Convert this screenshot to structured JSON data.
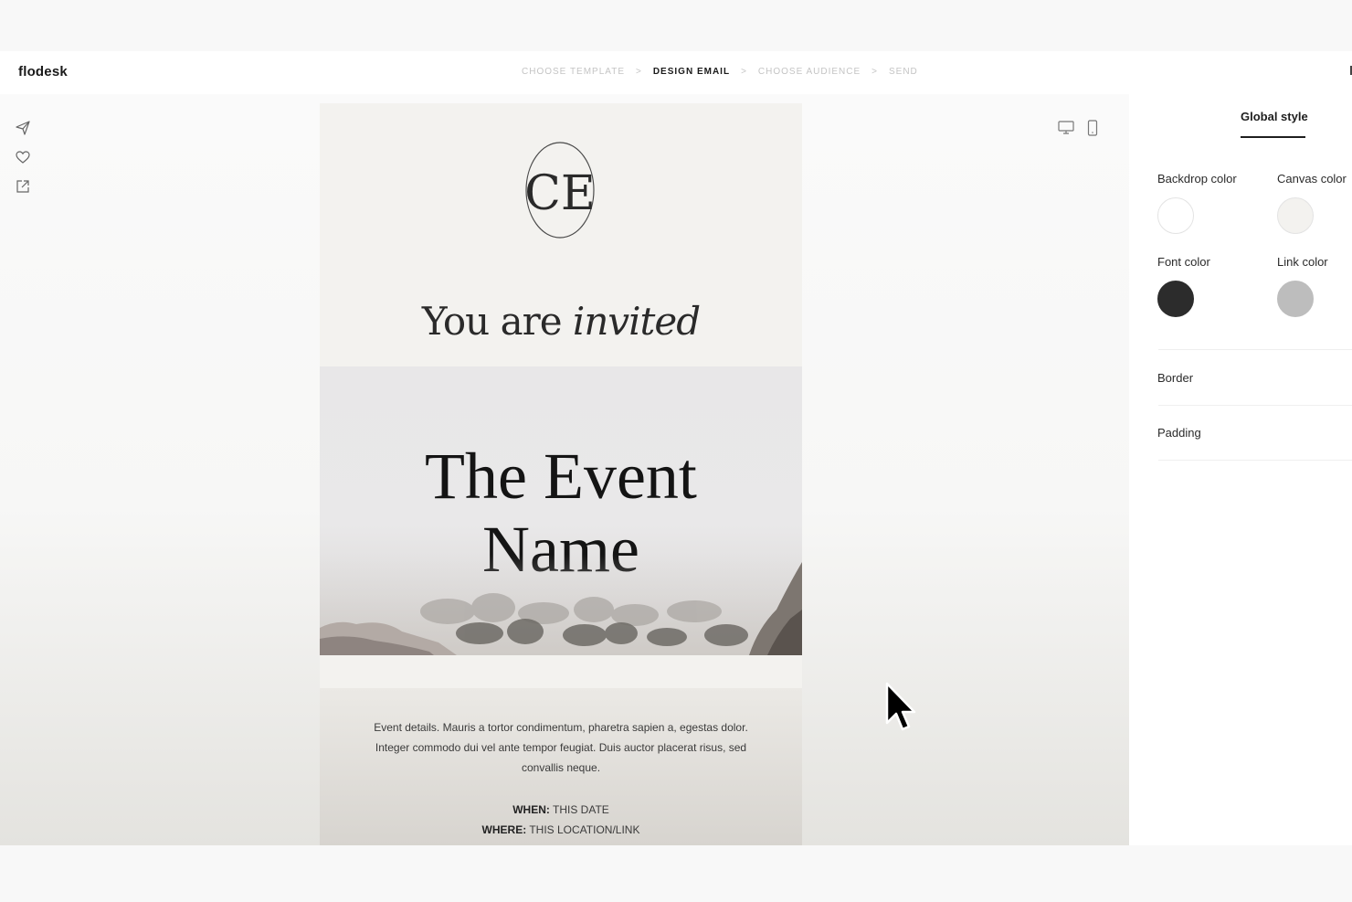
{
  "app": {
    "brand": "flodesk"
  },
  "steps": {
    "choose_template": "CHOOSE TEMPLATE",
    "design_email": "DESIGN EMAIL",
    "choose_audience": "CHOOSE AUDIENCE",
    "send": "SEND",
    "separator": ">",
    "active": "DESIGN EMAIL"
  },
  "left_tools": [
    "send-icon",
    "heart-icon",
    "external-link-icon"
  ],
  "view_toggles": [
    "desktop-icon",
    "mobile-icon"
  ],
  "email": {
    "monogram": "CE",
    "invited_plain": "You are ",
    "invited_italic": "invited",
    "event_name_line1": "The Event",
    "event_name_line2": "Name",
    "details": "Event details. Mauris a tortor condimentum, pharetra sapien a, egestas dolor. Integer commodo dui vel ante tempor feugiat. Duis auctor placerat risus, sed convallis neque.",
    "when_label": "WHEN:",
    "when_value": " THIS DATE",
    "where_label": "WHERE:",
    "where_value": " THIS LOCATION/LINK"
  },
  "panel": {
    "tab": "Global style",
    "backdrop_color_label": "Backdrop color",
    "canvas_color_label": "Canvas color",
    "font_color_label": "Font color",
    "link_color_label": "Link color",
    "border_label": "Border",
    "padding_label": "Padding",
    "colors": {
      "backdrop": "#ffffff",
      "canvas": "#f3f2ef",
      "font": "#2c2c2c",
      "link": "#bdbdbd"
    }
  }
}
